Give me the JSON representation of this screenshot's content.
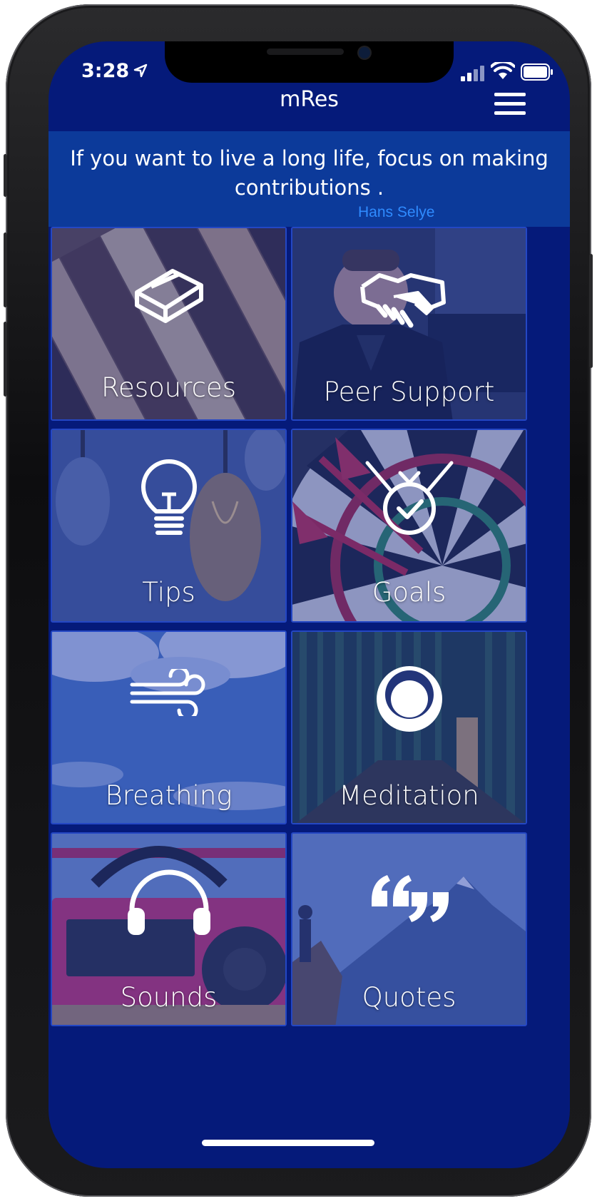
{
  "status_bar": {
    "time": "3:28"
  },
  "header": {
    "title": "mRes"
  },
  "quote": {
    "text": "If you want to live a long life, focus on making contributions .",
    "author": "Hans Selye"
  },
  "tiles": [
    {
      "label": "Resources",
      "icon": "book-icon"
    },
    {
      "label": "Peer Support",
      "icon": "handshake-icon"
    },
    {
      "label": "Tips",
      "icon": "lightbulb-icon"
    },
    {
      "label": "Goals",
      "icon": "goal-target-icon"
    },
    {
      "label": "Breathing",
      "icon": "wind-icon"
    },
    {
      "label": "Meditation",
      "icon": "meditation-icon"
    },
    {
      "label": "Sounds",
      "icon": "headphones-icon"
    },
    {
      "label": "Quotes",
      "icon": "quote-marks-icon"
    }
  ],
  "colors": {
    "app_background": "#051a7a",
    "banner": "#0c3a9a",
    "author_link": "#2f8bff",
    "tile_border": "#2447c4"
  }
}
